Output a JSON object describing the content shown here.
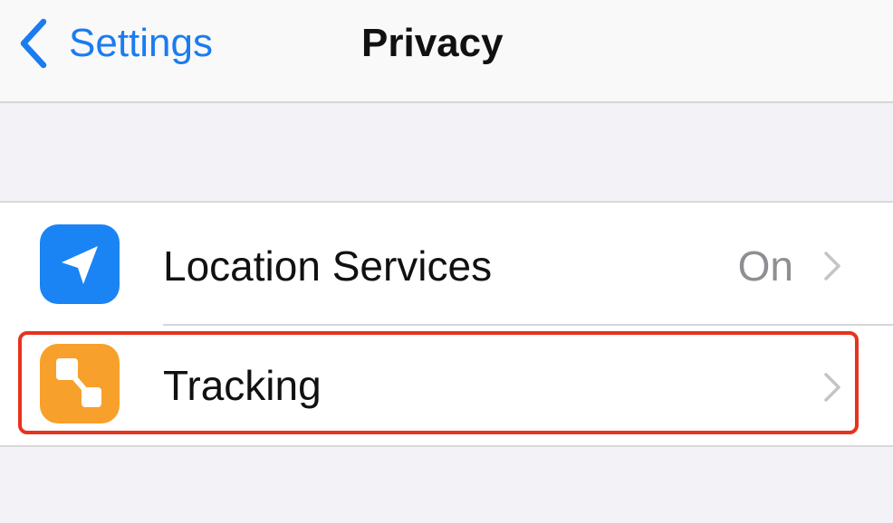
{
  "navbar": {
    "back_label": "Settings",
    "back_icon": "chevron-left-icon",
    "title": "Privacy"
  },
  "rows": [
    {
      "label": "Location Services",
      "value": "On",
      "icon": "location-arrow-icon",
      "icon_color": "#1a84f4",
      "accessory": "chevron-right-icon"
    },
    {
      "label": "Tracking",
      "value": "",
      "icon": "tracking-icon",
      "icon_color": "#f7a12c",
      "accessory": "chevron-right-icon",
      "highlighted": true
    }
  ],
  "colors": {
    "accent": "#1b7cf0",
    "highlight_border": "#e8321e",
    "background": "#f2f2f7",
    "secondary_text": "#8e8e93"
  }
}
